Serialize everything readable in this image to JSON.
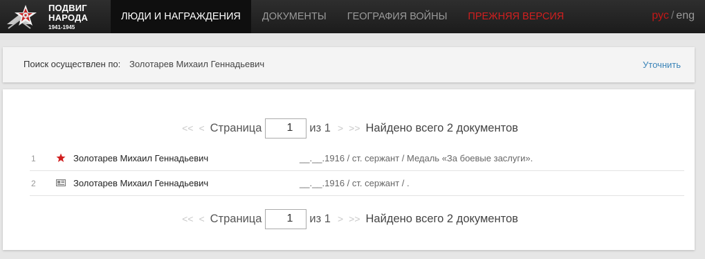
{
  "logo": {
    "line1": "ПОДВИГ",
    "line2": "НАРОДА",
    "years": "1941-1945"
  },
  "nav": {
    "items": [
      {
        "label": "ЛЮДИ И НАГРАЖДЕНИЯ",
        "active": true
      },
      {
        "label": "ДОКУМЕНТЫ"
      },
      {
        "label": "ГЕОГРАФИЯ ВОЙНЫ"
      },
      {
        "label": "ПРЕЖНЯЯ ВЕРСИЯ"
      }
    ],
    "accent_color": "#d11f1f"
  },
  "lang": {
    "ru": "рус",
    "sep": "/",
    "en": "eng"
  },
  "search": {
    "label": "Поиск осуществлен по:",
    "value": "Золотарев Михаил Геннадьевич",
    "refine": "Уточнить"
  },
  "pager": {
    "first": "<<",
    "prev": "<",
    "page_word": "Страница",
    "current": "1",
    "of": "из 1",
    "next": ">",
    "last": ">>",
    "found": "Найдено всего 2 документов"
  },
  "results": [
    {
      "num": "1",
      "icon": "red-star-icon",
      "name": "Золотарев Михаил Геннадьевич",
      "detail": "__.__.1916 /  ст. сержант /  Медаль «За боевые заслуги»."
    },
    {
      "num": "2",
      "icon": "document-card-icon",
      "name": "Золотарев Михаил Геннадьевич",
      "detail": "__.__.1916 /  ст. сержант /  ."
    }
  ]
}
